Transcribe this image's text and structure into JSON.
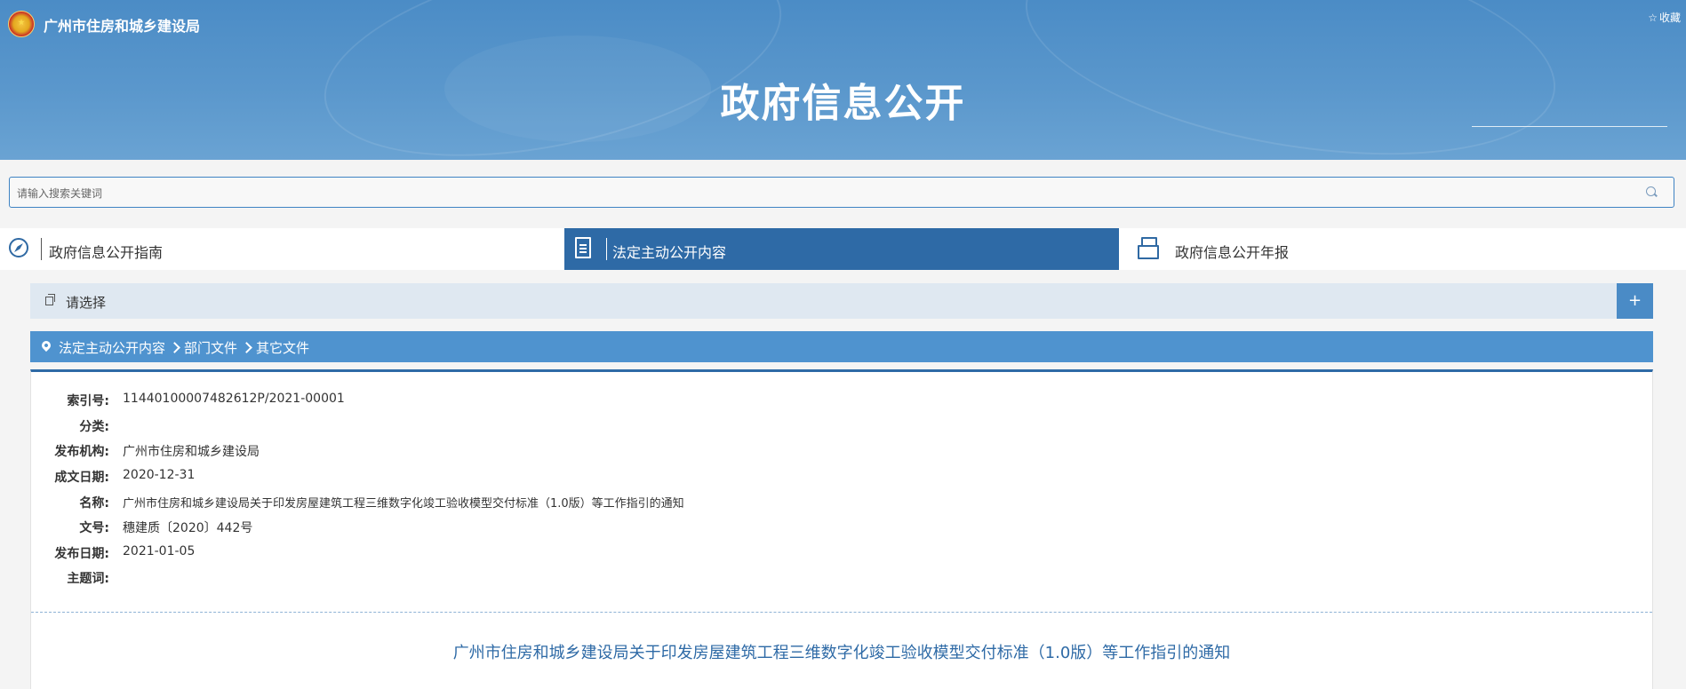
{
  "header": {
    "site_name": "广州市住房和城乡建设局",
    "favorite_label": "收藏",
    "banner_title": "政府信息公开"
  },
  "search": {
    "placeholder": "请输入搜索关键词"
  },
  "tabs": [
    {
      "label": "政府信息公开指南",
      "icon": "compass-icon",
      "active": false
    },
    {
      "label": "法定主动公开内容",
      "icon": "document-icon",
      "active": true
    },
    {
      "label": "政府信息公开年报",
      "icon": "folder-icon",
      "active": false
    }
  ],
  "selector": {
    "label": "请选择",
    "expand_label": "+"
  },
  "breadcrumb": [
    "法定主动公开内容",
    "部门文件",
    "其它文件"
  ],
  "info": [
    {
      "key": "索引号:",
      "value": "11440100007482612P/2021-00001"
    },
    {
      "key": "分类:",
      "value": ""
    },
    {
      "key": "发布机构:",
      "value": "广州市住房和城乡建设局"
    },
    {
      "key": "成文日期:",
      "value": "2020-12-31"
    },
    {
      "key": "名称:",
      "value": "广州市住房和城乡建设局关于印发房屋建筑工程三维数字化竣工验收模型交付标准（1.0版）等工作指引的通知"
    },
    {
      "key": "文号:",
      "value": "穗建质〔2020〕442号"
    },
    {
      "key": "发布日期:",
      "value": "2021-01-05"
    },
    {
      "key": "主题词:",
      "value": ""
    }
  ],
  "document_title": "广州市住房和城乡建设局关于印发房屋建筑工程三维数字化竣工验收模型交付标准（1.0版）等工作指引的通知",
  "colors": {
    "primary": "#2e6aa6",
    "breadcrumb_bg": "#4f93cf",
    "selector_bg": "#dfe8f1"
  }
}
